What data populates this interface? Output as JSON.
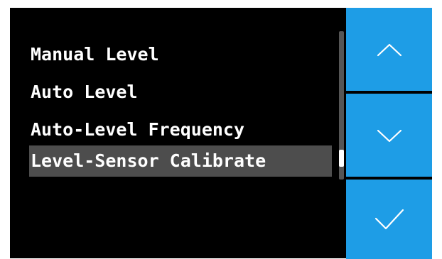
{
  "menu": {
    "items": [
      {
        "label": "Manual Level",
        "selected": false
      },
      {
        "label": "Auto Level",
        "selected": false
      },
      {
        "label": "Auto-Level Frequency",
        "selected": false
      },
      {
        "label": "Level-Sensor Calibrate",
        "selected": true
      }
    ]
  },
  "scroll": {
    "position": 0.9
  },
  "buttons": {
    "up_icon": "chevron-up-icon",
    "down_icon": "chevron-down-icon",
    "confirm_icon": "checkmark-icon"
  },
  "colors": {
    "background": "#000000",
    "button": "#1e9de6",
    "selection": "#4d4d4d",
    "text": "#ffffff"
  }
}
